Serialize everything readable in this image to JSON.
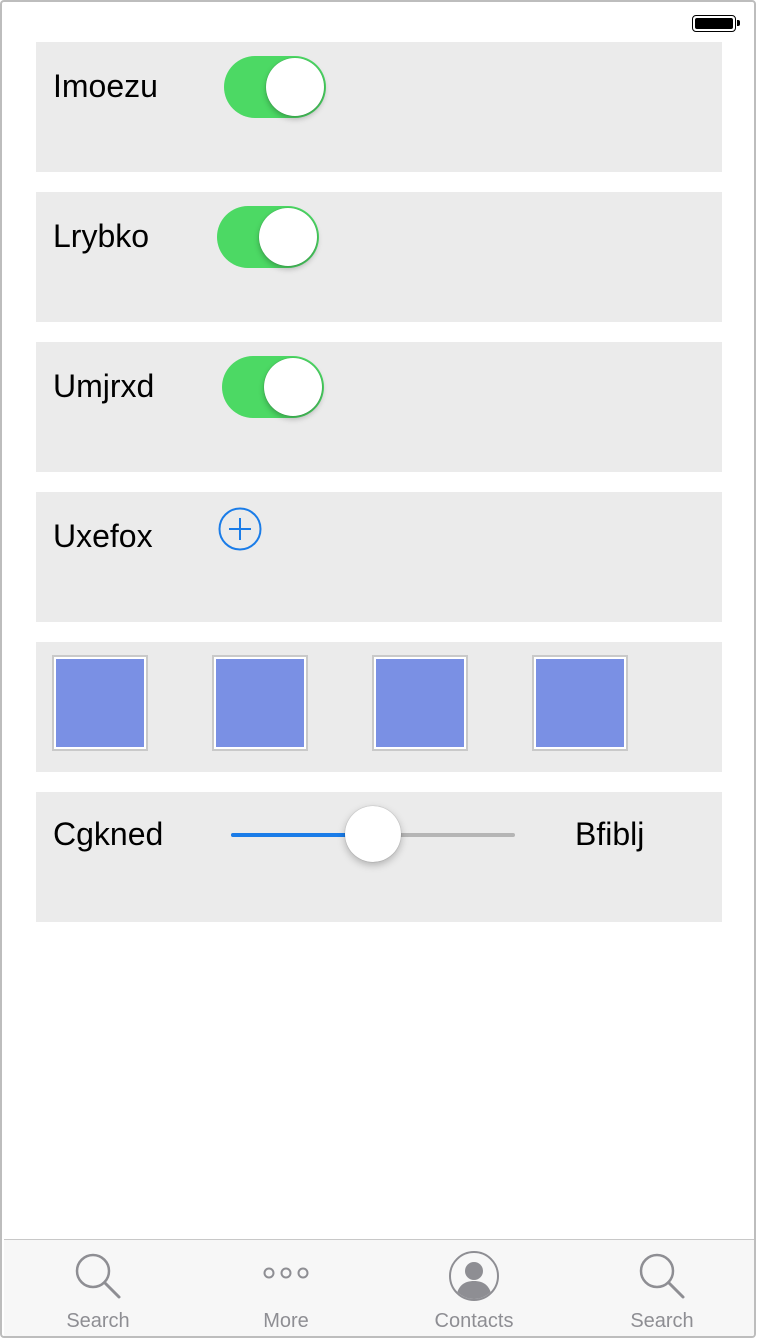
{
  "status_bar": {
    "battery_icon": "battery-full-icon"
  },
  "rows": {
    "toggle_1": {
      "label": "Imoezu",
      "on": true
    },
    "toggle_2": {
      "label": "Lrybko",
      "on": true
    },
    "toggle_3": {
      "label": "Umjrxd",
      "on": true
    },
    "add_row": {
      "label": "Uxefox",
      "icon": "plus-circle-icon"
    },
    "slider_row": {
      "min_label": "Cgkned",
      "max_label": "Bfiblj",
      "value": 0.5
    }
  },
  "tiles": {
    "count": 4,
    "color": "#7a90e4"
  },
  "colors": {
    "switch_on": "#4cd964",
    "accent": "#1a7ce8",
    "row_bg": "#ebebeb"
  },
  "tabbar": {
    "tabs": [
      {
        "label": "Search",
        "icon": "search-icon"
      },
      {
        "label": "More",
        "icon": "more-dots-icon"
      },
      {
        "label": "Contacts",
        "icon": "contact-avatar-icon"
      },
      {
        "label": "Search",
        "icon": "search-icon"
      }
    ]
  }
}
